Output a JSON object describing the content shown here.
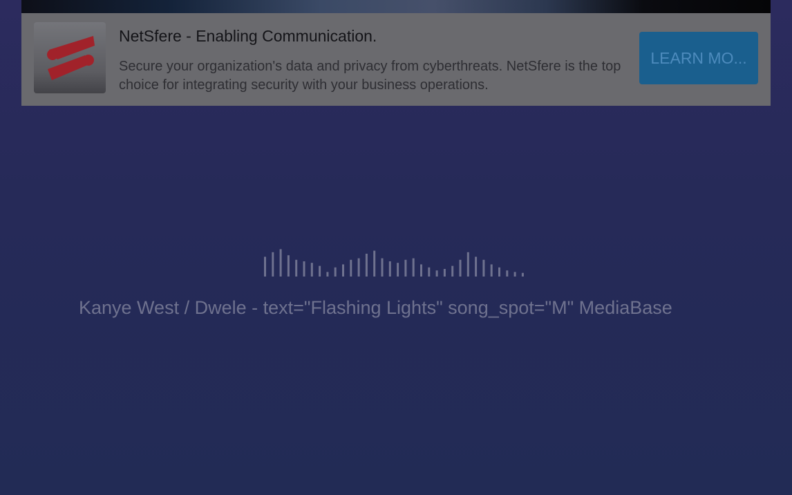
{
  "ad": {
    "title": "NetSfere - Enabling Communication.",
    "description": "Secure your organization's data and privacy from cyberthreats. NetSfere is the top choice for integrating security with your business operations.",
    "cta_label": "LEARN MO...",
    "logo_icon": "netsfere-logo-icon",
    "cta_color": "#1a5f8e",
    "logo_accent_color": "#b8232b"
  },
  "player": {
    "waveform_icon": "audio-waveform-icon",
    "track_text": "Kanye West / Dwele - text=\"Flashing Lights\" song_spot=\"M\" MediaBase"
  },
  "colors": {
    "background": "#262a58",
    "track_text": "#6f728f"
  }
}
